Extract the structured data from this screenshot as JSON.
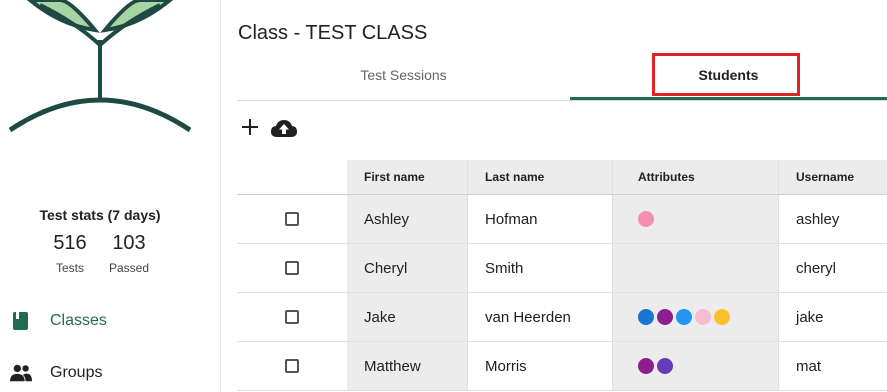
{
  "sidebar": {
    "stats_title": "Test stats (7 days)",
    "stats": [
      {
        "value": "516",
        "label": "Tests"
      },
      {
        "value": "103",
        "label": "Passed"
      }
    ],
    "nav": [
      {
        "label": "Classes",
        "icon": "book-icon",
        "active": true
      },
      {
        "label": "Groups",
        "icon": "people-icon",
        "active": false
      }
    ]
  },
  "main": {
    "title": "Class - TEST CLASS",
    "tabs": [
      {
        "label": "Test Sessions",
        "active": false
      },
      {
        "label": "Students",
        "active": true
      }
    ],
    "toolbar": {
      "add_icon": "plus-icon",
      "upload_icon": "cloud-upload-icon"
    }
  },
  "table": {
    "headers": [
      "",
      "First name",
      "Last name",
      "Attributes",
      "Username"
    ],
    "rows": [
      {
        "first": "Ashley",
        "last": "Hofman",
        "attributes": [
          "#f48fb1"
        ],
        "username": "ashley"
      },
      {
        "first": "Cheryl",
        "last": "Smith",
        "attributes": [],
        "username": "cheryl"
      },
      {
        "first": "Jake",
        "last": "van Heerden",
        "attributes": [
          "#1976d2",
          "#8e1e8f",
          "#2196f3",
          "#f8bbd0",
          "#fbc02d"
        ],
        "username": "jake"
      },
      {
        "first": "Matthew",
        "last": "Morris",
        "attributes": [
          "#8e1e8f",
          "#673ab7"
        ],
        "username": "mat"
      }
    ]
  },
  "colors": {
    "accent": "#1f6b53",
    "highlight": "#e02424"
  }
}
